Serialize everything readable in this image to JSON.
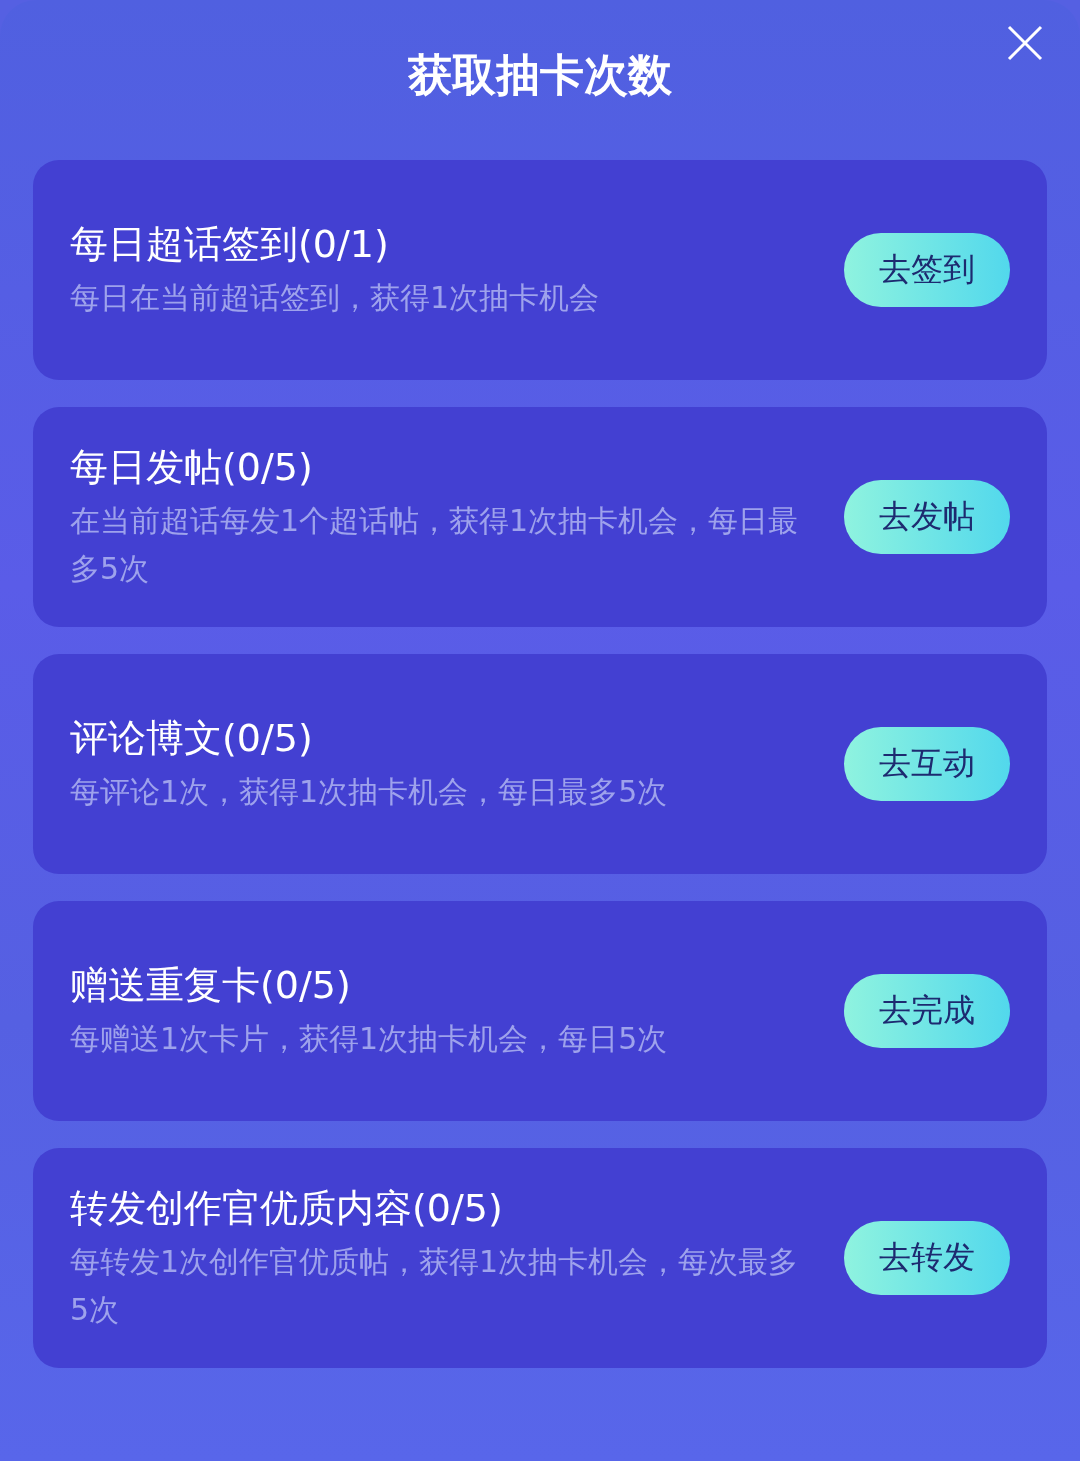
{
  "title": "获取抽卡次数",
  "tasks": [
    {
      "title": "每日超话签到(0/1)",
      "description": "每日在当前超话签到，获得1次抽卡机会",
      "button": "去签到"
    },
    {
      "title": "每日发帖(0/5)",
      "description": "在当前超话每发1个超话帖，获得1次抽卡机会，每日最多5次",
      "button": "去发帖"
    },
    {
      "title": "评论博文(0/5)",
      "description": "每评论1次，获得1次抽卡机会，每日最多5次",
      "button": "去互动"
    },
    {
      "title": "赠送重复卡(0/5)",
      "description": "每赠送1次卡片，获得1次抽卡机会，每日5次",
      "button": "去完成"
    },
    {
      "title": "转发创作官优质内容(0/5)",
      "description": "每转发1次创作官优质帖，获得1次抽卡机会，每次最多5次",
      "button": "去转发"
    }
  ]
}
